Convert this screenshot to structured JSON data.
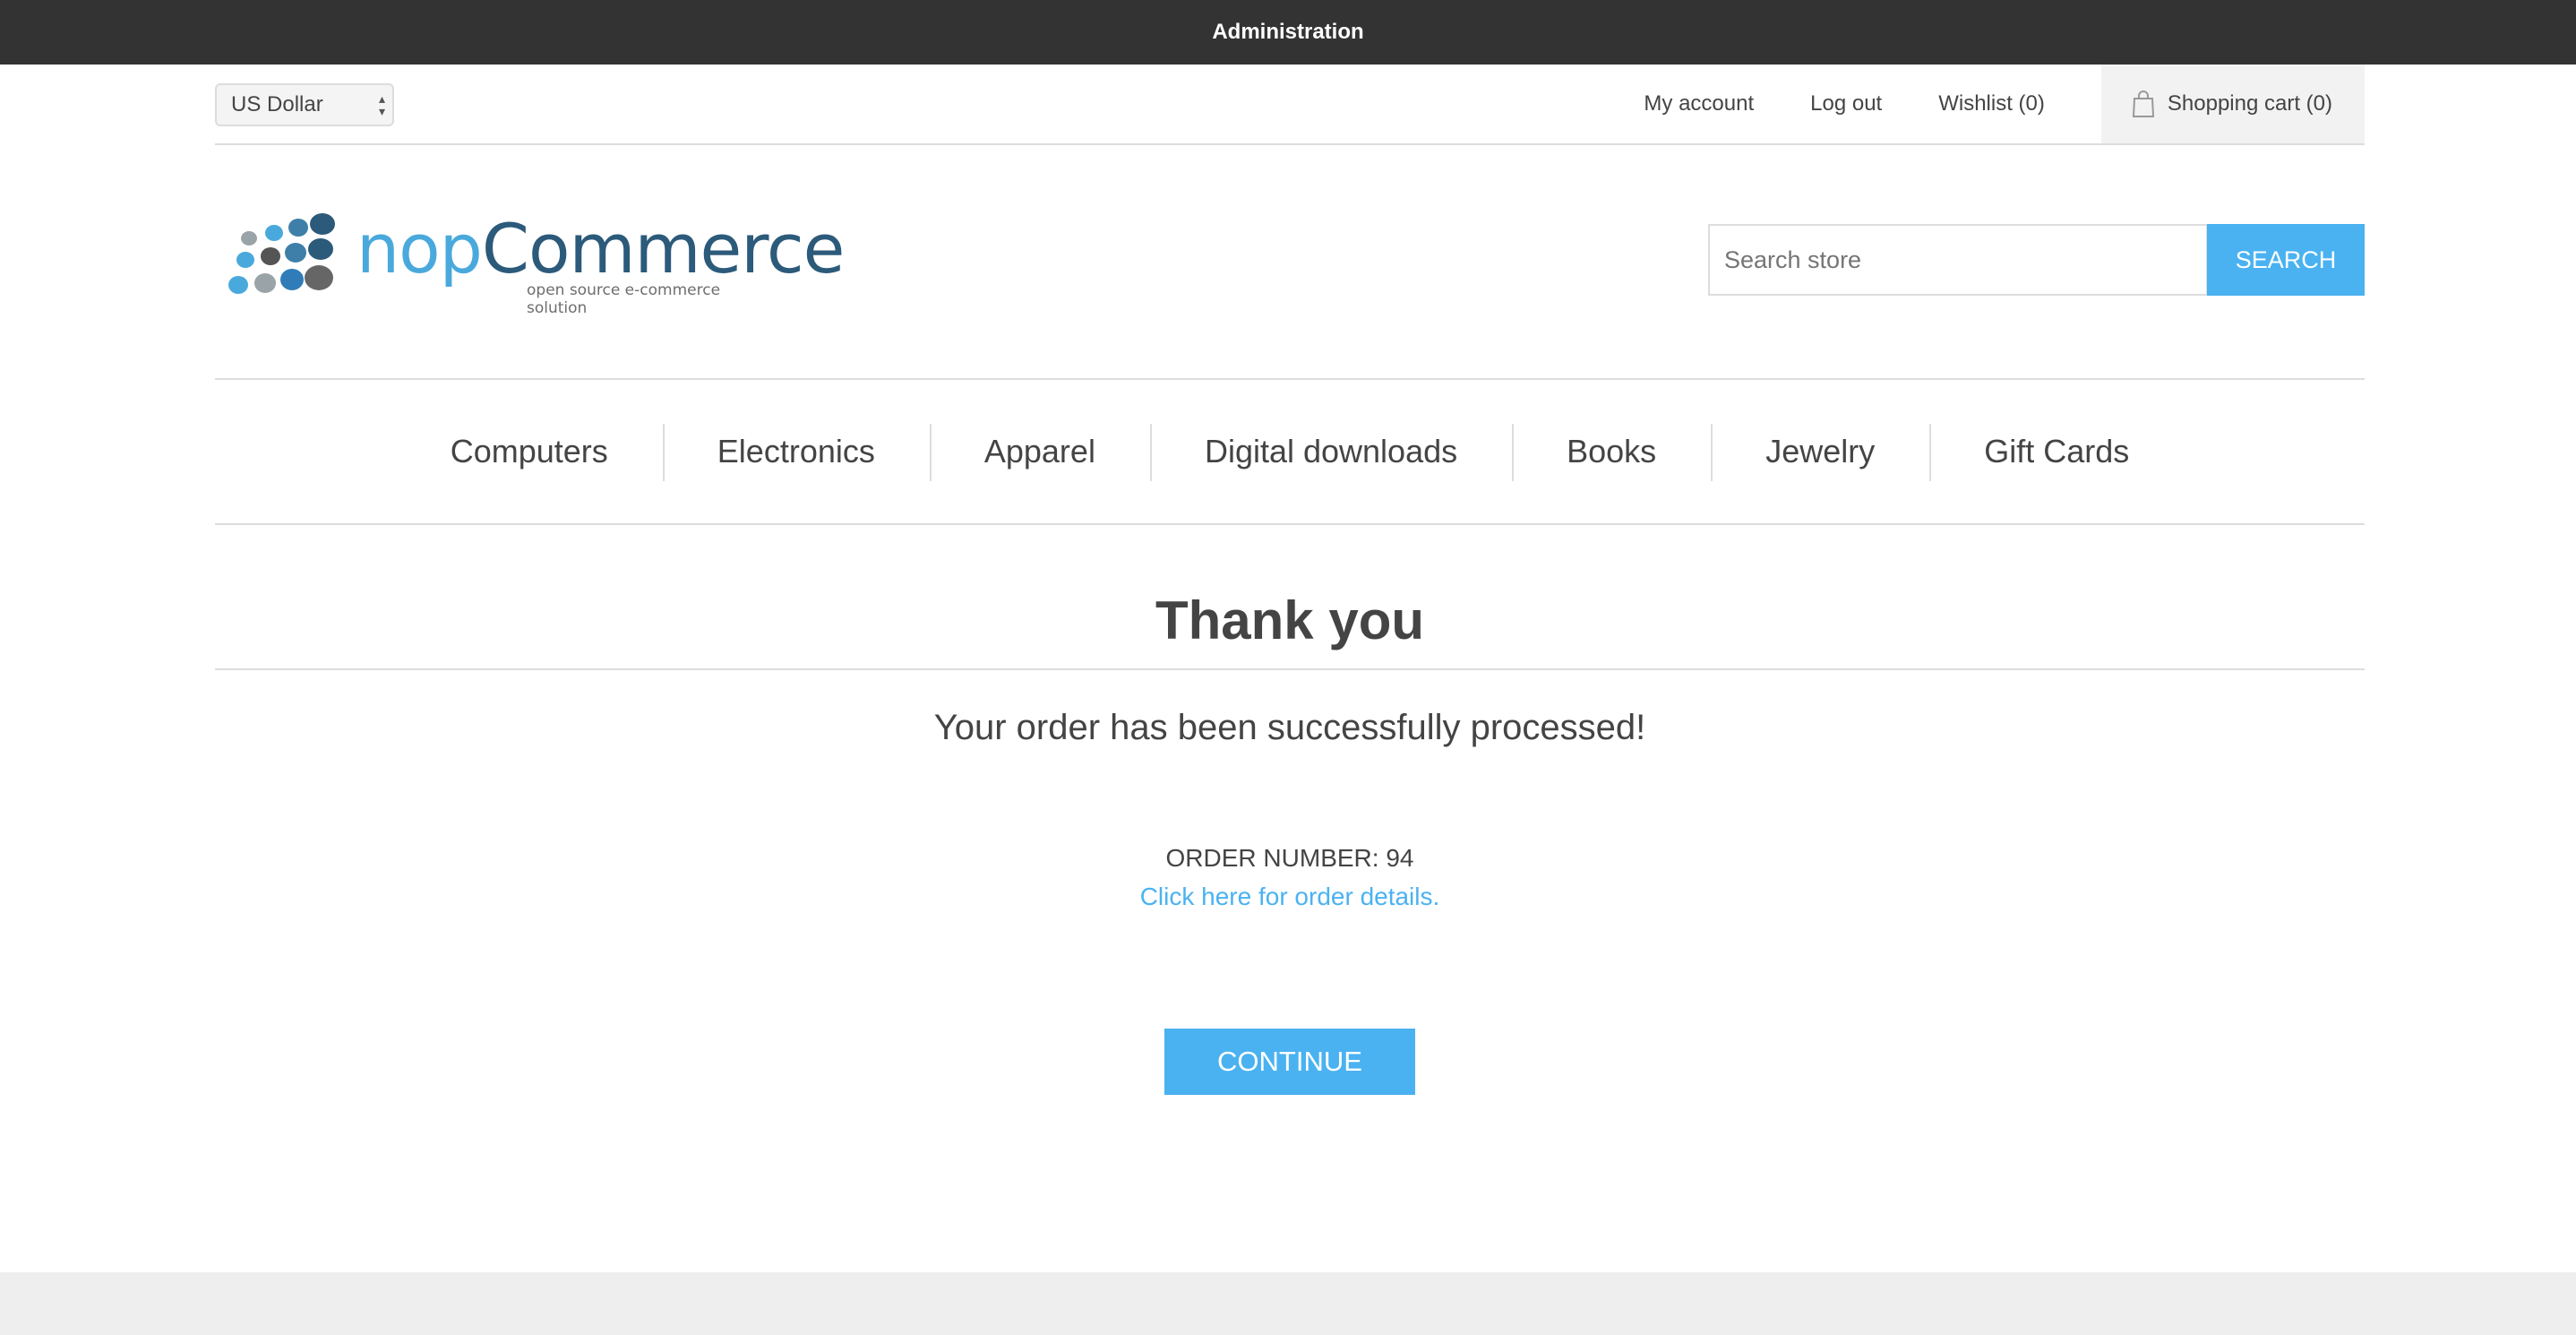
{
  "admin_bar": {
    "label": "Administration"
  },
  "header": {
    "currency": "US Dollar",
    "links": {
      "my_account": "My account",
      "logout": "Log out",
      "wishlist": "Wishlist (0)",
      "cart": "Shopping cart (0)"
    }
  },
  "logo": {
    "nop": "nop",
    "commerce": "Commerce",
    "tagline": "open source e-commerce solution"
  },
  "search": {
    "placeholder": "Search store",
    "button": "SEARCH"
  },
  "menu": [
    "Computers",
    "Electronics",
    "Apparel",
    "Digital downloads",
    "Books",
    "Jewelry",
    "Gift Cards"
  ],
  "content": {
    "title": "Thank you",
    "message": "Your order has been successfully processed!",
    "order_number": "ORDER NUMBER: 94",
    "details_link": "Click here for order details.",
    "continue": "CONTINUE"
  },
  "colors": {
    "accent": "#4ab2f1",
    "admin_bar": "#333333"
  }
}
